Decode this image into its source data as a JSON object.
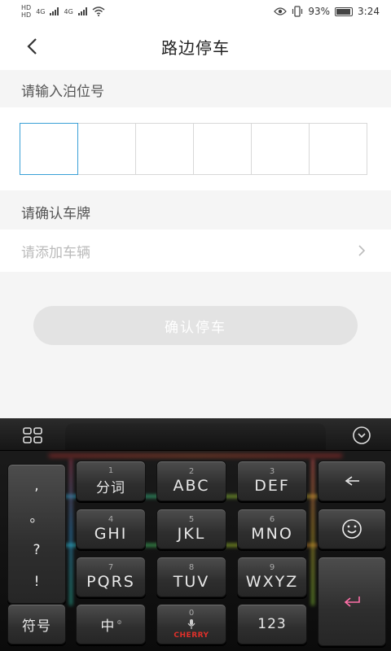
{
  "status": {
    "left_top": "HD",
    "left_bottom": "HD",
    "net1": "4G",
    "net2": "4G",
    "battery": "93%",
    "time": "3:24"
  },
  "header": {
    "title": "路边停车"
  },
  "parking_slot": {
    "label": "请输入泊位号",
    "box_count": 6,
    "active_index": 0
  },
  "plate": {
    "label": "请确认车牌",
    "placeholder": "请添加车辆"
  },
  "confirm_button": {
    "label": "确认停车"
  },
  "keyboard": {
    "punct": [
      ",",
      "。",
      "?",
      "!"
    ],
    "keys": [
      {
        "num": "1",
        "label": "分词"
      },
      {
        "num": "2",
        "label": "ABC"
      },
      {
        "num": "3",
        "label": "DEF"
      },
      {
        "num": "4",
        "label": "GHI"
      },
      {
        "num": "5",
        "label": "JKL"
      },
      {
        "num": "6",
        "label": "MNO"
      },
      {
        "num": "7",
        "label": "PQRS"
      },
      {
        "num": "8",
        "label": "TUV"
      },
      {
        "num": "9",
        "label": "WXYZ"
      }
    ],
    "symbol_label": "符号",
    "zh_label": "中",
    "space_num": "0",
    "space_brand": "CHERRY",
    "num_label": "123",
    "accent_colors": [
      "#2ec4ff",
      "#3fe8a0",
      "#f0c02e",
      "#ff3a3a"
    ]
  }
}
